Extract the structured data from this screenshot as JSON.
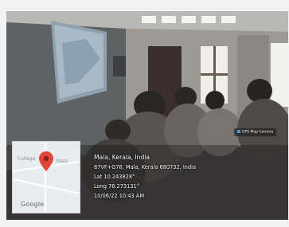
{
  "location": {
    "place": "Mala, Kerala, India",
    "address": "87VF+G78, Mala, Kerala 680732, India",
    "lat": "Lat 10.243828°",
    "long": "Long 76.273131°",
    "datetime": "10/06/22 10:43 AM"
  },
  "map": {
    "label_college": "College",
    "label_city": "Mala",
    "brand": "Google"
  },
  "app_badge": "GPS Map Camera",
  "colors": {
    "map_pin": "#e0463a",
    "overlay_text": "#ffffff"
  }
}
